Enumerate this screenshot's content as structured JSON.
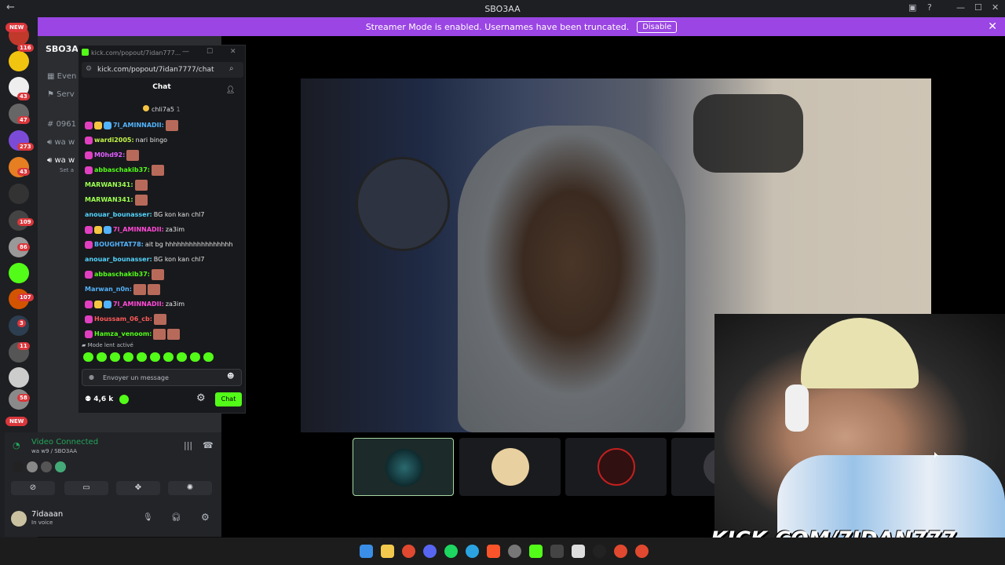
{
  "window": {
    "title": "SBO3AA"
  },
  "banner": {
    "text": "Streamer Mode is enabled. Usernames have been truncated.",
    "disable_label": "Disable"
  },
  "guild_badges": [
    "NEW",
    "116",
    "43",
    "47",
    "273",
    "43",
    "109",
    "86",
    "107",
    "3",
    "11",
    "58",
    "NEW"
  ],
  "sidebar": {
    "server_name": "SBO3AA",
    "items": [
      "Even",
      "Serv",
      "0961",
      "wa w",
      "wa w"
    ],
    "sub": "Set a"
  },
  "voice": {
    "status": "Video Connected",
    "channel": "wa w9 / SBO3AA",
    "user": "7idaaan",
    "user_status": "In voice"
  },
  "popout": {
    "title": "kick.com/popout/7idan777...",
    "url": "kick.com/popout/7idan7777/chat",
    "chat_header": "Chat",
    "pinned_user": "chli7a5",
    "pinned_count": "1",
    "slow_mode": "Mode lent activé",
    "input_placeholder": "Envoyer un message",
    "viewers": "4,6 k",
    "chat_button": "Chat"
  },
  "messages": [
    {
      "user": "7l_AMINNADII:",
      "text": "",
      "color": "#53b3fc",
      "badges": 3,
      "emotes": 1
    },
    {
      "user": "wardi2005:",
      "text": "nari bingo",
      "color": "#c2f54a",
      "badges": 1,
      "emotes": 0
    },
    {
      "user": "M0hd92:",
      "text": "",
      "color": "#e060ff",
      "badges": 1,
      "emotes": 1
    },
    {
      "user": "abbaschakib37:",
      "text": "",
      "color": "#53fc18",
      "badges": 1,
      "emotes": 1
    },
    {
      "user": "MARWAN341:",
      "text": "",
      "color": "#9cff50",
      "badges": 0,
      "emotes": 1
    },
    {
      "user": "MARWAN341:",
      "text": "",
      "color": "#9cff50",
      "badges": 0,
      "emotes": 1
    },
    {
      "user": "anouar_bounasser:",
      "text": "BG kon kan chl7",
      "color": "#53d3fc",
      "badges": 0,
      "emotes": 0
    },
    {
      "user": "7l_AMINNADII:",
      "text": "za3im",
      "color": "#ff4ad6",
      "badges": 3,
      "emotes": 0
    },
    {
      "user": "BOUGHTAT78:",
      "text": "ait bg hhhhhhhhhhhhhhhhh",
      "color": "#53b3fc",
      "badges": 1,
      "emotes": 0
    },
    {
      "user": "anouar_bounasser:",
      "text": "BG kon kan chl7",
      "color": "#53d3fc",
      "badges": 0,
      "emotes": 0
    },
    {
      "user": "abbaschakib37:",
      "text": "",
      "color": "#53fc18",
      "badges": 1,
      "emotes": 1
    },
    {
      "user": "Marwan_n0n:",
      "text": "",
      "color": "#53b3fc",
      "badges": 0,
      "emotes": 2
    },
    {
      "user": "7l_AMINNADII:",
      "text": "za3im",
      "color": "#ff4ad6",
      "badges": 3,
      "emotes": 0
    },
    {
      "user": "Houssam_06_cb:",
      "text": "",
      "color": "#ff5a5a",
      "badges": 1,
      "emotes": 1
    },
    {
      "user": "Hamza_venoom:",
      "text": "",
      "color": "#53fc18",
      "badges": 1,
      "emotes": 2
    }
  ],
  "overlay": {
    "brand": "KICK.COM/7IDAN777"
  },
  "colors": {
    "accent_purple": "#9b45e4",
    "kick_green": "#53fc18",
    "discord_green": "#23a55a"
  }
}
